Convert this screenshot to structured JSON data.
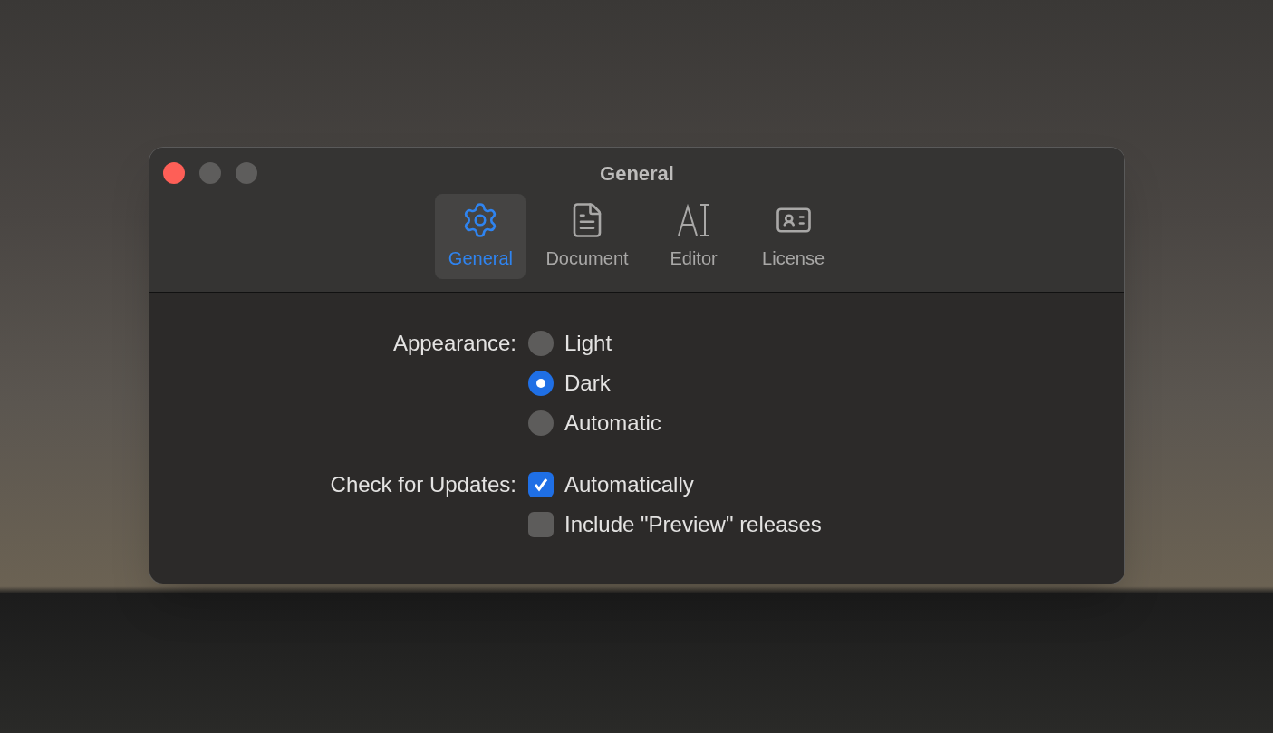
{
  "window": {
    "title": "General"
  },
  "tabs": [
    {
      "label": "General",
      "selected": true,
      "kind": "gear"
    },
    {
      "label": "Document",
      "selected": false,
      "kind": "document"
    },
    {
      "label": "Editor",
      "selected": false,
      "kind": "text"
    },
    {
      "label": "License",
      "selected": false,
      "kind": "card"
    }
  ],
  "settings": [
    {
      "label": "Appearance:",
      "kind": "radio",
      "options": [
        {
          "label": "Light",
          "selected": false
        },
        {
          "label": "Dark",
          "selected": true
        },
        {
          "label": "Automatic",
          "selected": false
        }
      ]
    },
    {
      "label": "Check for Updates:",
      "kind": "checkbox",
      "options": [
        {
          "label": "Automatically",
          "checked": true
        },
        {
          "label": "Include \"Preview\" releases",
          "checked": false
        }
      ]
    }
  ]
}
